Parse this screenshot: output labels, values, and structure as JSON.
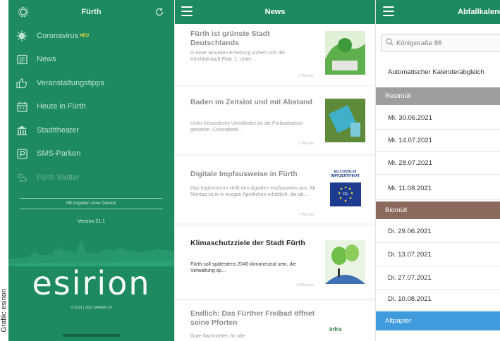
{
  "credit": "Grafik: esirion",
  "sidebar": {
    "title": "Fürth",
    "items": [
      {
        "label": "Coronavirus",
        "badge": "NEU",
        "icon": "virus-icon"
      },
      {
        "label": "News",
        "icon": "newspaper-icon"
      },
      {
        "label": "Veranstaltungstipps",
        "icon": "thumbs-up-icon"
      },
      {
        "label": "Heute in Fürth",
        "icon": "calendar-icon"
      },
      {
        "label": "Stadttheater",
        "icon": "theater-icon"
      },
      {
        "label": "SMS-Parken",
        "icon": "parking-icon"
      },
      {
        "label": "Fürth Wetter",
        "icon": "weather-icon"
      }
    ],
    "ads_text": "Mit Angaben ohne Gewähr",
    "version": "Version 21.1",
    "logo": "esirion",
    "footer": "© 2021 | 2022 MAREN 24"
  },
  "news": {
    "title": "News",
    "items": [
      {
        "title": "Fürth ist grünste Stadt Deutschlands",
        "text": "In einer aktuellen Erhebung sichert sich die Kleeblattstadt Platz 1. Unter…",
        "meta": "1 Woche"
      },
      {
        "title": "Baden im Zeitslot und mit Abstand",
        "text": "Unter besonderen Umständen ist die Freibadsaison gestartet. Coronabedi…",
        "meta": "1 Woche"
      },
      {
        "title": "Digitale Impfausweise in Fürth",
        "text": "Das Impfzentrum stellt den digitalen Impfausweis aus. Ab Montag ist er in einigen Apotheken erhältlich, die ab…",
        "meta": "1 Woche",
        "badge_text": "EU COVID-19 IMPFZERTIFIKAT"
      },
      {
        "title": "Klimaschutzziele der Stadt Fürth",
        "text": "Fürth soll spätestens 2040 klimaneutral sein, die Verwaltung sp…",
        "meta": "3 Wochen"
      },
      {
        "title": "Endlich: Das Fürther Freibad öffnet seine Pforten",
        "text": "Gute Nachrichten für alle",
        "meta": "",
        "logo_text": "infra"
      }
    ]
  },
  "calendar": {
    "title": "Abfallkalender",
    "search_value": "Königstraße 88",
    "auto_label": "Automatischer Kalenderabgleich",
    "sections": [
      {
        "label": "Restmüll",
        "color": "#9e9e9e",
        "dates": [
          "Mi. 30.06.2021",
          "Mi. 14.07.2021",
          "Mi. 28.07.2021",
          "Mi. 11.08.2021"
        ]
      },
      {
        "label": "Biomüll",
        "color": "#8a6a5c",
        "dates": [
          "Di. 29.06.2021",
          "Di. 13.07.2021",
          "Di. 27.07.2021",
          "Di. 10.08.2021"
        ]
      },
      {
        "label": "Altpapier",
        "color": "#3f9bdc",
        "dates": []
      }
    ]
  },
  "colors": {
    "brand_green": "#1e8a5f",
    "news_bar_green": "#1e8a5f"
  }
}
